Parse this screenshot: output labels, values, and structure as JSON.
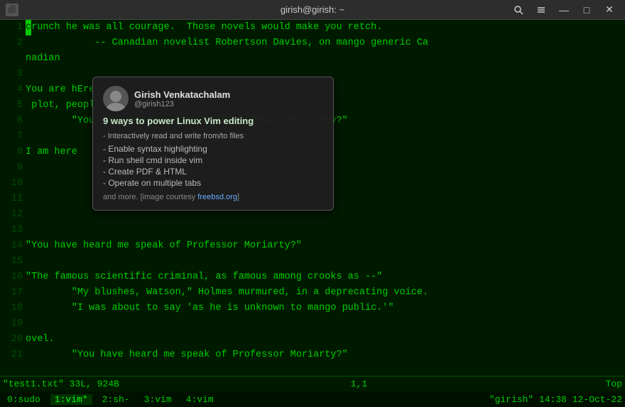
{
  "titlebar": {
    "title": "girish@girish: ~",
    "icon": "⬛",
    "minimize": "—",
    "maximize": "□",
    "close": "✕"
  },
  "editor": {
    "lines": [
      {
        "num": "1",
        "content": "crunch he was all courage.  Those novels would make you retch."
      },
      {
        "num": "2",
        "content": "            -- Canadian novelist Robertson Davies, on mango generic Ca"
      },
      {
        "num": "",
        "content": "nadian"
      },
      {
        "num": "3",
        "content": ""
      },
      {
        "num": "4",
        "content": "You are hEre"
      },
      {
        "num": "5",
        "content": " plot, people came to"
      },
      {
        "num": "6",
        "content": "        \"You have heard me speak of Professor Moriarty?\""
      },
      {
        "num": "7",
        "content": ""
      },
      {
        "num": "8",
        "content": "I am here"
      },
      {
        "num": "9",
        "content": ""
      },
      {
        "num": "10",
        "content": ""
      },
      {
        "num": "11",
        "content": ""
      },
      {
        "num": "12",
        "content": ""
      },
      {
        "num": "13",
        "content": ""
      },
      {
        "num": "14",
        "content": "\"You have heard me speak of Professor Moriarty?\""
      },
      {
        "num": "15",
        "content": ""
      },
      {
        "num": "16",
        "content": "\"The famous scientific criminal, as famous among crooks as --\""
      },
      {
        "num": "17",
        "content": "        \"My blushes, Watson,\" Holmes murmured, in a deprecating voice."
      },
      {
        "num": "18",
        "content": "        \"I was about to say 'as he is unknown to mango public.'\""
      },
      {
        "num": "19",
        "content": ""
      },
      {
        "num": "20",
        "content": "ovel."
      },
      {
        "num": "21",
        "content": "        \"You have heard me speak of Professor Moriarty?\""
      }
    ]
  },
  "statusbar": {
    "filename": "\"test1.txt\"",
    "fileinfo": "33L, 924B",
    "position": "1,1",
    "scroll": "Top"
  },
  "tabbar": {
    "tabs": [
      {
        "id": "0",
        "label": "0:sudo"
      },
      {
        "id": "1",
        "label": "1:vim*"
      },
      {
        "id": "2",
        "label": "2:sh-"
      },
      {
        "id": "3",
        "label": "3:vim"
      },
      {
        "id": "4",
        "label": "4:vim"
      }
    ],
    "username": "\"girish\"",
    "time": "14:38",
    "date": "12-Oct-22"
  },
  "notification": {
    "user_name": "Girish Venkatachalam",
    "user_handle": "@girish123",
    "title": "9 ways to power Linux Vim editing",
    "section_label": "- Interactively read and write from/to files",
    "items": [
      "Enable syntax highlighting",
      "Run shell cmd inside vim",
      "Create PDF & HTML",
      "Operate on multiple tabs"
    ],
    "footer_text": "and more. [image courtesy ",
    "footer_link": "freebsd.org",
    "footer_end": "]"
  }
}
